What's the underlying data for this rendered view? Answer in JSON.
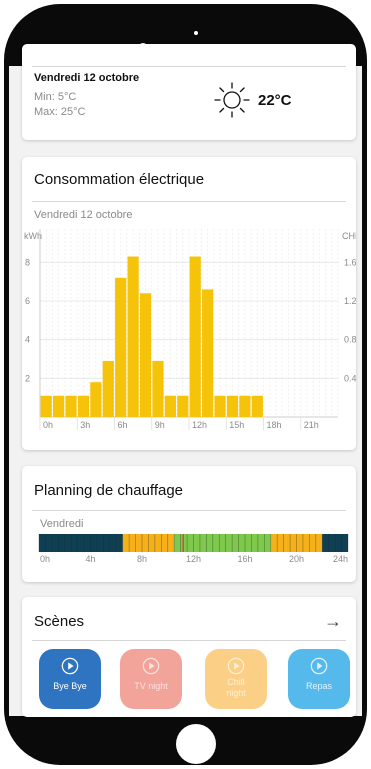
{
  "weather": {
    "day": "Vendredi 12 octobre",
    "min": "Min: 5°C",
    "max": "Max: 25°C",
    "temperature": "22°C",
    "icon": "sun-icon"
  },
  "consumption": {
    "title": "Consommation électrique",
    "subtitle": "Vendredi 12 octobre"
  },
  "chart_data": {
    "type": "bar",
    "title": "Consommation électrique",
    "subtitle": "Vendredi 12 octobre",
    "ylabel": "kWh",
    "y2label": "CHF",
    "ylim": [
      0,
      9
    ],
    "y2lim": [
      0,
      1.8
    ],
    "y_ticks": [
      "2",
      "4",
      "6",
      "8"
    ],
    "y2_ticks": [
      "0.4",
      "0.8",
      "1.2",
      "1.6"
    ],
    "x_tick_labels": [
      "0h",
      "3h",
      "6h",
      "9h",
      "12h",
      "15h",
      "18h",
      "21h"
    ],
    "categories": [
      "0h",
      "1h",
      "2h",
      "3h",
      "4h",
      "5h",
      "6h",
      "7h",
      "8h",
      "9h",
      "10h",
      "11h",
      "12h",
      "13h",
      "14h",
      "15h",
      "16h",
      "17h",
      "18h",
      "19h",
      "20h",
      "21h",
      "22h",
      "23h"
    ],
    "values": [
      1.1,
      1.1,
      1.1,
      1.1,
      1.8,
      2.9,
      7.2,
      8.3,
      6.4,
      2.9,
      1.1,
      1.1,
      8.3,
      6.6,
      1.1,
      1.1,
      1.1,
      1.1,
      0,
      0,
      0,
      0,
      0,
      0
    ],
    "color": "#f5c30a",
    "grid": true
  },
  "heating": {
    "title": "Planning de chauffage",
    "day": "Vendredi",
    "hour_labels": [
      "0h",
      "4h",
      "8h",
      "12h",
      "16h",
      "20h",
      "24h"
    ],
    "segments": [
      {
        "from": 0,
        "to": 6.5,
        "mode": "night",
        "color": "#0e3f52"
      },
      {
        "from": 6.5,
        "to": 10.5,
        "mode": "eco",
        "color": "#f5b01a"
      },
      {
        "from": 10.5,
        "to": 18,
        "mode": "comfort",
        "color": "#7ec94b"
      },
      {
        "from": 18,
        "to": 22,
        "mode": "eco",
        "color": "#f5b01a"
      },
      {
        "from": 22,
        "to": 24,
        "mode": "night",
        "color": "#0e3f52"
      }
    ],
    "current_hour": 11.2,
    "current_color": "#e23b3b"
  },
  "scenes": {
    "title": "Scènes",
    "arrow": "→",
    "items": [
      {
        "label": "Bye Bye",
        "color": "#2f74c0",
        "text_color": "#ffffff"
      },
      {
        "label": "TV night",
        "color": "#f2a39a",
        "text_color": "#fbe3e0"
      },
      {
        "label": "Chill night",
        "color": "#fbcf85",
        "text_color": "#fff1d6"
      },
      {
        "label": "Repas",
        "color": "#56b9ec",
        "text_color": "#e1f3fd"
      }
    ]
  }
}
